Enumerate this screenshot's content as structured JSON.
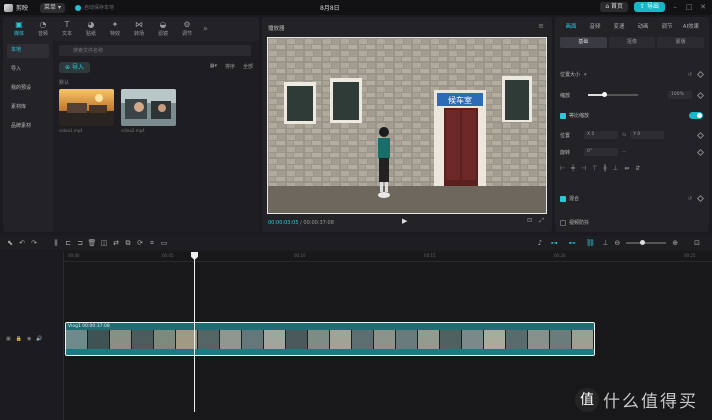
{
  "app": {
    "name": "剪映",
    "menu_label": "菜单",
    "project_title": "8月8日",
    "status_text": "自动保存本地"
  },
  "top_right": {
    "home_label": "首页",
    "export_label": "导出"
  },
  "media_tabs": [
    {
      "label": "媒体",
      "icon": "media-icon"
    },
    {
      "label": "音频",
      "icon": "audio-icon"
    },
    {
      "label": "文本",
      "icon": "text-icon"
    },
    {
      "label": "贴纸",
      "icon": "sticker-icon"
    },
    {
      "label": "特效",
      "icon": "effects-icon"
    },
    {
      "label": "转场",
      "icon": "transition-icon"
    },
    {
      "label": "滤镜",
      "icon": "filter-icon"
    },
    {
      "label": "调节",
      "icon": "adjust-icon"
    }
  ],
  "media_sidebar": [
    "本地",
    "导入",
    "我的预设",
    "素材库",
    "品牌素材"
  ],
  "media": {
    "search_placeholder": "搜索文件名称",
    "import_label": "导入",
    "view_ctrls": [
      "排序",
      "全部"
    ],
    "group_label": "默认",
    "items": [
      {
        "name": "video1.mp4"
      },
      {
        "name": "video2.mp4"
      }
    ]
  },
  "preview": {
    "title": "播放器",
    "current_time": "00:00:03:05",
    "total_time": "00:00:37:08"
  },
  "props": {
    "tabs": [
      "画面",
      "音频",
      "变速",
      "动画",
      "调节",
      "AI效果"
    ],
    "subtabs": [
      "基础",
      "抠像",
      "蒙版"
    ],
    "section_title": "位置大小",
    "scale_label": "缩放",
    "scale_value": "100%",
    "uniform_label": "等比缩放",
    "position_label": "位置",
    "pos_x": "X 0",
    "pos_y": "Y 0",
    "rotate_label": "旋转",
    "rotate_value": "0°",
    "mix_label": "混合",
    "stab_label": "视频防抖"
  },
  "timeline": {
    "ruler": [
      "00:00",
      "00:05",
      "00:10",
      "00:15",
      "00:20",
      "00:25",
      "00:30",
      "00:35",
      "00:40"
    ],
    "clip_label": "Vlog1  00:00:37:08"
  },
  "watermark": {
    "badge": "值",
    "text": "什么值得买"
  }
}
